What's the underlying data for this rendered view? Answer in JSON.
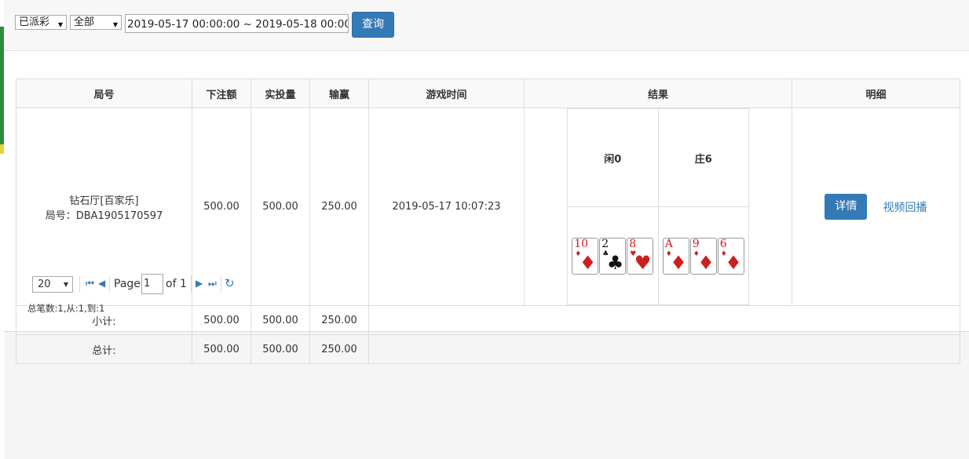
{
  "toolbar": {
    "status_select": "已派彩",
    "type_select": "全部",
    "date_range": "2019-05-17 00:00:00 ~ 2019-05-18 00:00:00",
    "query_button": "查询"
  },
  "table": {
    "headers": [
      "局号",
      "下注额",
      "实投量",
      "输赢",
      "游戏时间",
      "结果",
      "明细"
    ],
    "row": {
      "room": "钻石厅[百家乐]",
      "round_id": "局号：DBA1905170597",
      "bet": "500.00",
      "valid_bet": "500.00",
      "win_loss": "250.00",
      "time": "2019-05-17 10:07:23",
      "detail_button": "详情",
      "video_link": "视频回播"
    },
    "result": {
      "player_label": "闲0",
      "banker_label": "庄6",
      "player_cards": [
        {
          "rank": "10",
          "suit": "♦",
          "color": "#cc1f1f"
        },
        {
          "rank": "2",
          "suit": "♣",
          "color": "#111111"
        },
        {
          "rank": "8",
          "suit": "♥",
          "color": "#cc1f1f"
        }
      ],
      "banker_cards": [
        {
          "rank": "A",
          "suit": "♦",
          "color": "#cc1f1f"
        },
        {
          "rank": "9",
          "suit": "♦",
          "color": "#cc1f1f"
        },
        {
          "rank": "6",
          "suit": "♦",
          "color": "#cc1f1f"
        }
      ]
    },
    "subtotal": {
      "label": "小计:",
      "bet": "500.00",
      "valid_bet": "500.00",
      "win_loss": "250.00"
    },
    "total": {
      "label": "总计:",
      "bet": "500.00",
      "valid_bet": "500.00",
      "win_loss": "250.00"
    }
  },
  "pager": {
    "page_size": "20",
    "page_label": "Page",
    "page_value": "1",
    "of_label": "of 1",
    "summary": "总笔数:1,从:1,到:1"
  },
  "colors": {
    "accent": "#337ab7"
  }
}
